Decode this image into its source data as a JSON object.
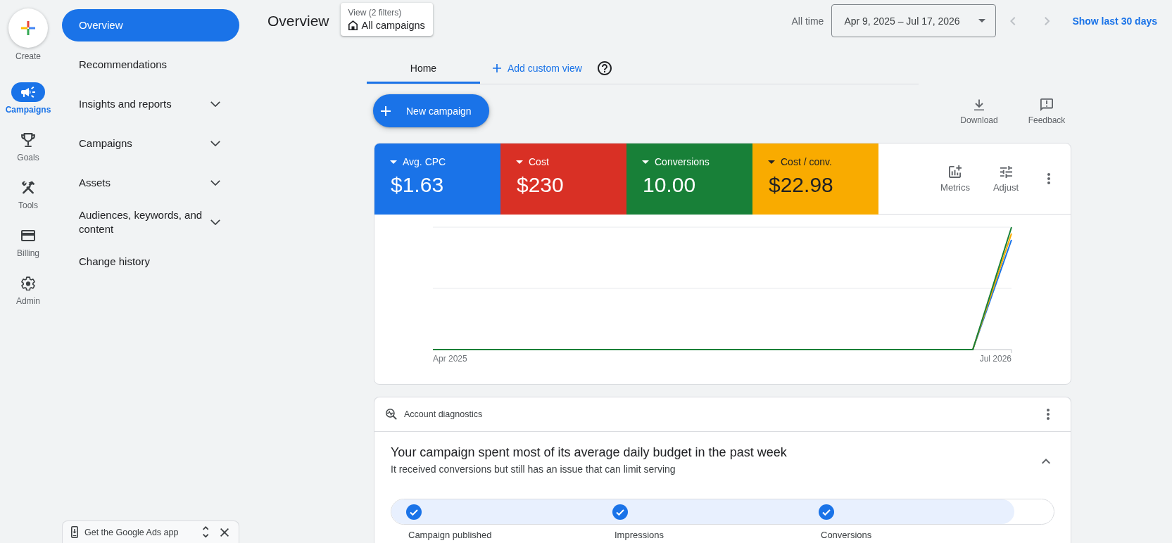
{
  "rail": {
    "create": {
      "label": "Create"
    },
    "items": [
      {
        "label": "Campaigns",
        "selected": true
      },
      {
        "label": "Goals",
        "selected": false
      },
      {
        "label": "Tools",
        "selected": false
      },
      {
        "label": "Billing",
        "selected": false
      },
      {
        "label": "Admin",
        "selected": false
      }
    ]
  },
  "nav": {
    "items": [
      {
        "label": "Overview",
        "selected": true,
        "expandable": false
      },
      {
        "label": "Recommendations",
        "selected": false,
        "expandable": false
      },
      {
        "label": "Insights and reports",
        "selected": false,
        "expandable": true,
        "expanded": false
      },
      {
        "label": "Campaigns",
        "selected": false,
        "expandable": true,
        "expanded": false
      },
      {
        "label": "Assets",
        "selected": false,
        "expandable": true,
        "expanded": false
      },
      {
        "label": "Audiences, keywords, and content",
        "selected": false,
        "expandable": true,
        "expanded": false
      },
      {
        "label": "Change history",
        "selected": false,
        "expandable": false
      }
    ],
    "app_banner": {
      "label": "Get the Google Ads app"
    }
  },
  "header": {
    "title": "Overview",
    "view_filter": {
      "caption": "View (2 filters)",
      "value": "All campaigns"
    },
    "range_label": "All time",
    "date_range": "Apr 9, 2025 – Jul 17, 2026",
    "shortcut": "Show last 30 days"
  },
  "tabs": [
    {
      "label": "Home",
      "kind": "view",
      "selected": true
    },
    {
      "label": "Add custom view",
      "kind": "add",
      "selected": false
    }
  ],
  "toolbar": {
    "new_button": "New campaign",
    "actions": [
      {
        "label": "Download"
      },
      {
        "label": "Feedback"
      }
    ]
  },
  "performance": {
    "tiles": [
      {
        "label": "Avg. CPC",
        "value": "$1.63",
        "color": "#1a73e8"
      },
      {
        "label": "Cost",
        "value": "$230",
        "color": "#d93025"
      },
      {
        "label": "Conversions",
        "value": "10.00",
        "color": "#188038"
      },
      {
        "label": "Cost / conv.",
        "value": "$22.98",
        "color": "#f9ab00"
      }
    ],
    "actions": [
      {
        "label": "Metrics"
      },
      {
        "label": "Adjust"
      }
    ],
    "chart": {
      "x_labels": [
        "Apr 2025",
        "Jul 2026"
      ]
    }
  },
  "diagnostics": {
    "heading": "Account diagnostics",
    "title": "Your campaign spent most of its average daily budget in the past week",
    "subtitle": "It received conversions but still has an issue that can limit serving",
    "expanded": true,
    "progress": {
      "level": 0.94
    },
    "steps": [
      {
        "label": "Campaign published",
        "done": true
      },
      {
        "label": "Impressions",
        "done": true
      },
      {
        "label": "Conversions",
        "done": true
      }
    ]
  }
}
